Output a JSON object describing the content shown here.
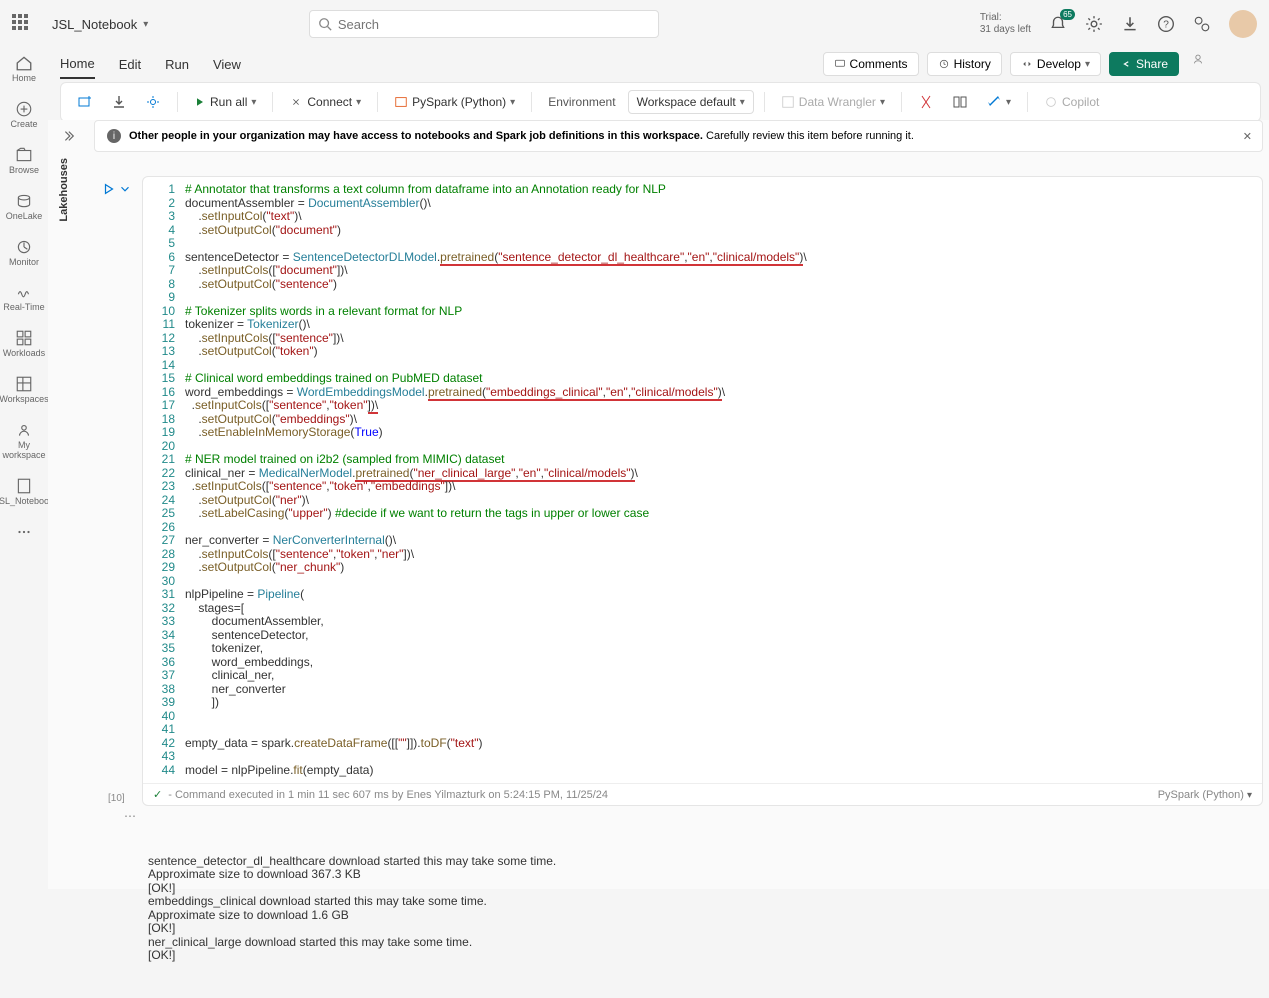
{
  "header": {
    "notebook_name": "JSL_Notebook",
    "search_placeholder": "Search",
    "trial_line1": "Trial:",
    "trial_line2": "31 days left",
    "notif_badge": "65"
  },
  "ribbon": {
    "tabs": [
      "Home",
      "Edit",
      "Run",
      "View"
    ],
    "comments": "Comments",
    "history": "History",
    "develop": "Develop",
    "share": "Share"
  },
  "toolbar": {
    "run_all": "Run all",
    "connect": "Connect",
    "pyspark": "PySpark (Python)",
    "environment": "Environment",
    "workspace_default": "Workspace default",
    "data_wrangler": "Data Wrangler",
    "copilot": "Copilot"
  },
  "rail": {
    "home": "Home",
    "create": "Create",
    "browse": "Browse",
    "onelake": "OneLake",
    "monitor": "Monitor",
    "realtime": "Real-Time",
    "workloads": "Workloads",
    "workspaces": "Workspaces",
    "myworkspace": "My workspace",
    "notebook": "JSL_Notebook"
  },
  "banner": {
    "bold": "Other people in your organization may have access to notebooks and Spark job definitions in this workspace.",
    "rest": " Carefully review this item before running it."
  },
  "lakehouses_label": "Lakehouses",
  "cell": {
    "exec_count": "[10]",
    "footer_status": "- Command executed in 1 min 11 sec 607 ms by Enes Yilmazturk on 5:24:15 PM, 11/25/24",
    "lang": "PySpark (Python)"
  },
  "code_lines": [
    {
      "n": 1,
      "segs": [
        {
          "t": "# Annotator that transforms a text column from dataframe into an Annotation ready for NLP",
          "c": "cm"
        }
      ]
    },
    {
      "n": 2,
      "segs": [
        {
          "t": "documentAssembler = "
        },
        {
          "t": "DocumentAssembler",
          "c": "cls"
        },
        {
          "t": "()\\"
        }
      ]
    },
    {
      "n": 3,
      "segs": [
        {
          "t": "    ."
        },
        {
          "t": "setInputCol",
          "c": "fn"
        },
        {
          "t": "("
        },
        {
          "t": "\"text\"",
          "c": "str"
        },
        {
          "t": ")\\"
        }
      ]
    },
    {
      "n": 4,
      "segs": [
        {
          "t": "    ."
        },
        {
          "t": "setOutputCol",
          "c": "fn"
        },
        {
          "t": "("
        },
        {
          "t": "\"document\"",
          "c": "str"
        },
        {
          "t": ")"
        }
      ]
    },
    {
      "n": 5,
      "segs": []
    },
    {
      "n": 6,
      "segs": [
        {
          "t": "sentenceDetector = "
        },
        {
          "t": "SentenceDetectorDLModel",
          "c": "cls"
        },
        {
          "t": "."
        },
        {
          "t": "pretrained",
          "c": "fn",
          "u": true
        },
        {
          "t": "(",
          "u": true
        },
        {
          "t": "\"sentence_detector_dl_healthcare\"",
          "c": "str",
          "u": true
        },
        {
          "t": ",",
          "u": true
        },
        {
          "t": "\"en\"",
          "c": "str",
          "u": true
        },
        {
          "t": ",",
          "u": true
        },
        {
          "t": "\"clinical/models\"",
          "c": "str",
          "u": true
        },
        {
          "t": ")",
          "u": true
        },
        {
          "t": "\\"
        }
      ]
    },
    {
      "n": 7,
      "segs": [
        {
          "t": "    ."
        },
        {
          "t": "setInputCols",
          "c": "fn"
        },
        {
          "t": "(["
        },
        {
          "t": "\"document\"",
          "c": "str"
        },
        {
          "t": "])\\"
        }
      ]
    },
    {
      "n": 8,
      "segs": [
        {
          "t": "    ."
        },
        {
          "t": "setOutputCol",
          "c": "fn"
        },
        {
          "t": "("
        },
        {
          "t": "\"sentence\"",
          "c": "str"
        },
        {
          "t": ")"
        }
      ]
    },
    {
      "n": 9,
      "segs": []
    },
    {
      "n": 10,
      "segs": [
        {
          "t": "# Tokenizer splits words in a relevant format for NLP",
          "c": "cm"
        }
      ]
    },
    {
      "n": 11,
      "segs": [
        {
          "t": "tokenizer = "
        },
        {
          "t": "Tokenizer",
          "c": "cls"
        },
        {
          "t": "()\\"
        }
      ]
    },
    {
      "n": 12,
      "segs": [
        {
          "t": "    ."
        },
        {
          "t": "setInputCols",
          "c": "fn"
        },
        {
          "t": "(["
        },
        {
          "t": "\"sentence\"",
          "c": "str"
        },
        {
          "t": "])\\"
        }
      ]
    },
    {
      "n": 13,
      "segs": [
        {
          "t": "    ."
        },
        {
          "t": "setOutputCol",
          "c": "fn"
        },
        {
          "t": "("
        },
        {
          "t": "\"token\"",
          "c": "str"
        },
        {
          "t": ")"
        }
      ]
    },
    {
      "n": 14,
      "segs": []
    },
    {
      "n": 15,
      "segs": [
        {
          "t": "# Clinical word embeddings trained on PubMED dataset",
          "c": "cm"
        }
      ]
    },
    {
      "n": 16,
      "segs": [
        {
          "t": "word_embeddings = "
        },
        {
          "t": "WordEmbeddingsModel",
          "c": "cls"
        },
        {
          "t": "."
        },
        {
          "t": "pretrained",
          "c": "fn",
          "u": true
        },
        {
          "t": "(",
          "u": true
        },
        {
          "t": "\"embeddings_clinical\"",
          "c": "str",
          "u": true
        },
        {
          "t": ",",
          "u": true
        },
        {
          "t": "\"en\"",
          "c": "str",
          "u": true
        },
        {
          "t": ",",
          "u": true
        },
        {
          "t": "\"clinical/models\"",
          "c": "str",
          "u": true
        },
        {
          "t": ")",
          "u": true
        },
        {
          "t": "\\"
        }
      ]
    },
    {
      "n": 17,
      "segs": [
        {
          "t": "  ."
        },
        {
          "t": "setInputCols",
          "c": "fn"
        },
        {
          "t": "(["
        },
        {
          "t": "\"sentence\"",
          "c": "str"
        },
        {
          "t": ","
        },
        {
          "t": "\"token\"",
          "c": "str"
        },
        {
          "t": "])\\",
          "u": true
        }
      ]
    },
    {
      "n": 18,
      "segs": [
        {
          "t": "    ."
        },
        {
          "t": "setOutputCol",
          "c": "fn"
        },
        {
          "t": "("
        },
        {
          "t": "\"embeddings\"",
          "c": "str"
        },
        {
          "t": ")\\"
        }
      ]
    },
    {
      "n": 19,
      "segs": [
        {
          "t": "    ."
        },
        {
          "t": "setEnableInMemoryStorage",
          "c": "fn"
        },
        {
          "t": "("
        },
        {
          "t": "True",
          "c": "kw"
        },
        {
          "t": ")"
        }
      ]
    },
    {
      "n": 20,
      "segs": []
    },
    {
      "n": 21,
      "segs": [
        {
          "t": "# NER model trained on i2b2 (sampled from MIMIC) dataset",
          "c": "cm"
        }
      ]
    },
    {
      "n": 22,
      "segs": [
        {
          "t": "clinical_ner = "
        },
        {
          "t": "MedicalNerModel",
          "c": "cls"
        },
        {
          "t": "."
        },
        {
          "t": "pretrained",
          "c": "fn",
          "u": true
        },
        {
          "t": "(",
          "u": true
        },
        {
          "t": "\"ner_clinical_large\"",
          "c": "str",
          "u": true
        },
        {
          "t": ",",
          "u": true
        },
        {
          "t": "\"en\"",
          "c": "str",
          "u": true
        },
        {
          "t": ",",
          "u": true
        },
        {
          "t": "\"clinical/models\"",
          "c": "str",
          "u": true
        },
        {
          "t": ")",
          "u": true
        },
        {
          "t": "\\"
        }
      ]
    },
    {
      "n": 23,
      "segs": [
        {
          "t": "  ."
        },
        {
          "t": "setInputCols",
          "c": "fn"
        },
        {
          "t": "(["
        },
        {
          "t": "\"sentence\"",
          "c": "str"
        },
        {
          "t": ","
        },
        {
          "t": "\"token\"",
          "c": "str"
        },
        {
          "t": ","
        },
        {
          "t": "\"embeddings\"",
          "c": "str"
        },
        {
          "t": "])\\"
        }
      ]
    },
    {
      "n": 24,
      "segs": [
        {
          "t": "    ."
        },
        {
          "t": "setOutputCol",
          "c": "fn"
        },
        {
          "t": "("
        },
        {
          "t": "\"ner\"",
          "c": "str"
        },
        {
          "t": ")\\"
        }
      ]
    },
    {
      "n": 25,
      "segs": [
        {
          "t": "    ."
        },
        {
          "t": "setLabelCasing",
          "c": "fn"
        },
        {
          "t": "("
        },
        {
          "t": "\"upper\"",
          "c": "str"
        },
        {
          "t": ") "
        },
        {
          "t": "#decide if we want to return the tags in upper or lower case",
          "c": "cm"
        }
      ]
    },
    {
      "n": 26,
      "segs": []
    },
    {
      "n": 27,
      "segs": [
        {
          "t": "ner_converter = "
        },
        {
          "t": "NerConverterInternal",
          "c": "cls"
        },
        {
          "t": "()\\"
        }
      ]
    },
    {
      "n": 28,
      "segs": [
        {
          "t": "    ."
        },
        {
          "t": "setInputCols",
          "c": "fn"
        },
        {
          "t": "(["
        },
        {
          "t": "\"sentence\"",
          "c": "str"
        },
        {
          "t": ","
        },
        {
          "t": "\"token\"",
          "c": "str"
        },
        {
          "t": ","
        },
        {
          "t": "\"ner\"",
          "c": "str"
        },
        {
          "t": "])\\"
        }
      ]
    },
    {
      "n": 29,
      "segs": [
        {
          "t": "    ."
        },
        {
          "t": "setOutputCol",
          "c": "fn"
        },
        {
          "t": "("
        },
        {
          "t": "\"ner_chunk\"",
          "c": "str"
        },
        {
          "t": ")"
        }
      ]
    },
    {
      "n": 30,
      "segs": []
    },
    {
      "n": 31,
      "segs": [
        {
          "t": "nlpPipeline = "
        },
        {
          "t": "Pipeline",
          "c": "cls"
        },
        {
          "t": "("
        }
      ]
    },
    {
      "n": 32,
      "segs": [
        {
          "t": "    stages=["
        }
      ]
    },
    {
      "n": 33,
      "segs": [
        {
          "t": "        documentAssembler,"
        }
      ]
    },
    {
      "n": 34,
      "segs": [
        {
          "t": "        sentenceDetector,"
        }
      ]
    },
    {
      "n": 35,
      "segs": [
        {
          "t": "        tokenizer,"
        }
      ]
    },
    {
      "n": 36,
      "segs": [
        {
          "t": "        word_embeddings,"
        }
      ]
    },
    {
      "n": 37,
      "segs": [
        {
          "t": "        clinical_ner,"
        }
      ]
    },
    {
      "n": 38,
      "segs": [
        {
          "t": "        ner_converter"
        }
      ]
    },
    {
      "n": 39,
      "segs": [
        {
          "t": "        ])"
        }
      ]
    },
    {
      "n": 40,
      "segs": []
    },
    {
      "n": 41,
      "segs": []
    },
    {
      "n": 42,
      "segs": [
        {
          "t": "empty_data = spark."
        },
        {
          "t": "createDataFrame",
          "c": "fn"
        },
        {
          "t": "([["
        },
        {
          "t": "\"\"",
          "c": "str"
        },
        {
          "t": "]])."
        },
        {
          "t": "toDF",
          "c": "fn"
        },
        {
          "t": "("
        },
        {
          "t": "\"text\"",
          "c": "str"
        },
        {
          "t": ")"
        }
      ]
    },
    {
      "n": 43,
      "segs": []
    },
    {
      "n": 44,
      "segs": [
        {
          "t": "model = nlpPipeline."
        },
        {
          "t": "fit",
          "c": "fn"
        },
        {
          "t": "(empty_data)"
        }
      ]
    }
  ],
  "output_lines": [
    "sentence_detector_dl_healthcare download started this may take some time.",
    "Approximate size to download 367.3 KB",
    "[OK!]",
    "embeddings_clinical download started this may take some time.",
    "Approximate size to download 1.6 GB",
    "[OK!]",
    "ner_clinical_large download started this may take some time.",
    "[OK!]"
  ]
}
